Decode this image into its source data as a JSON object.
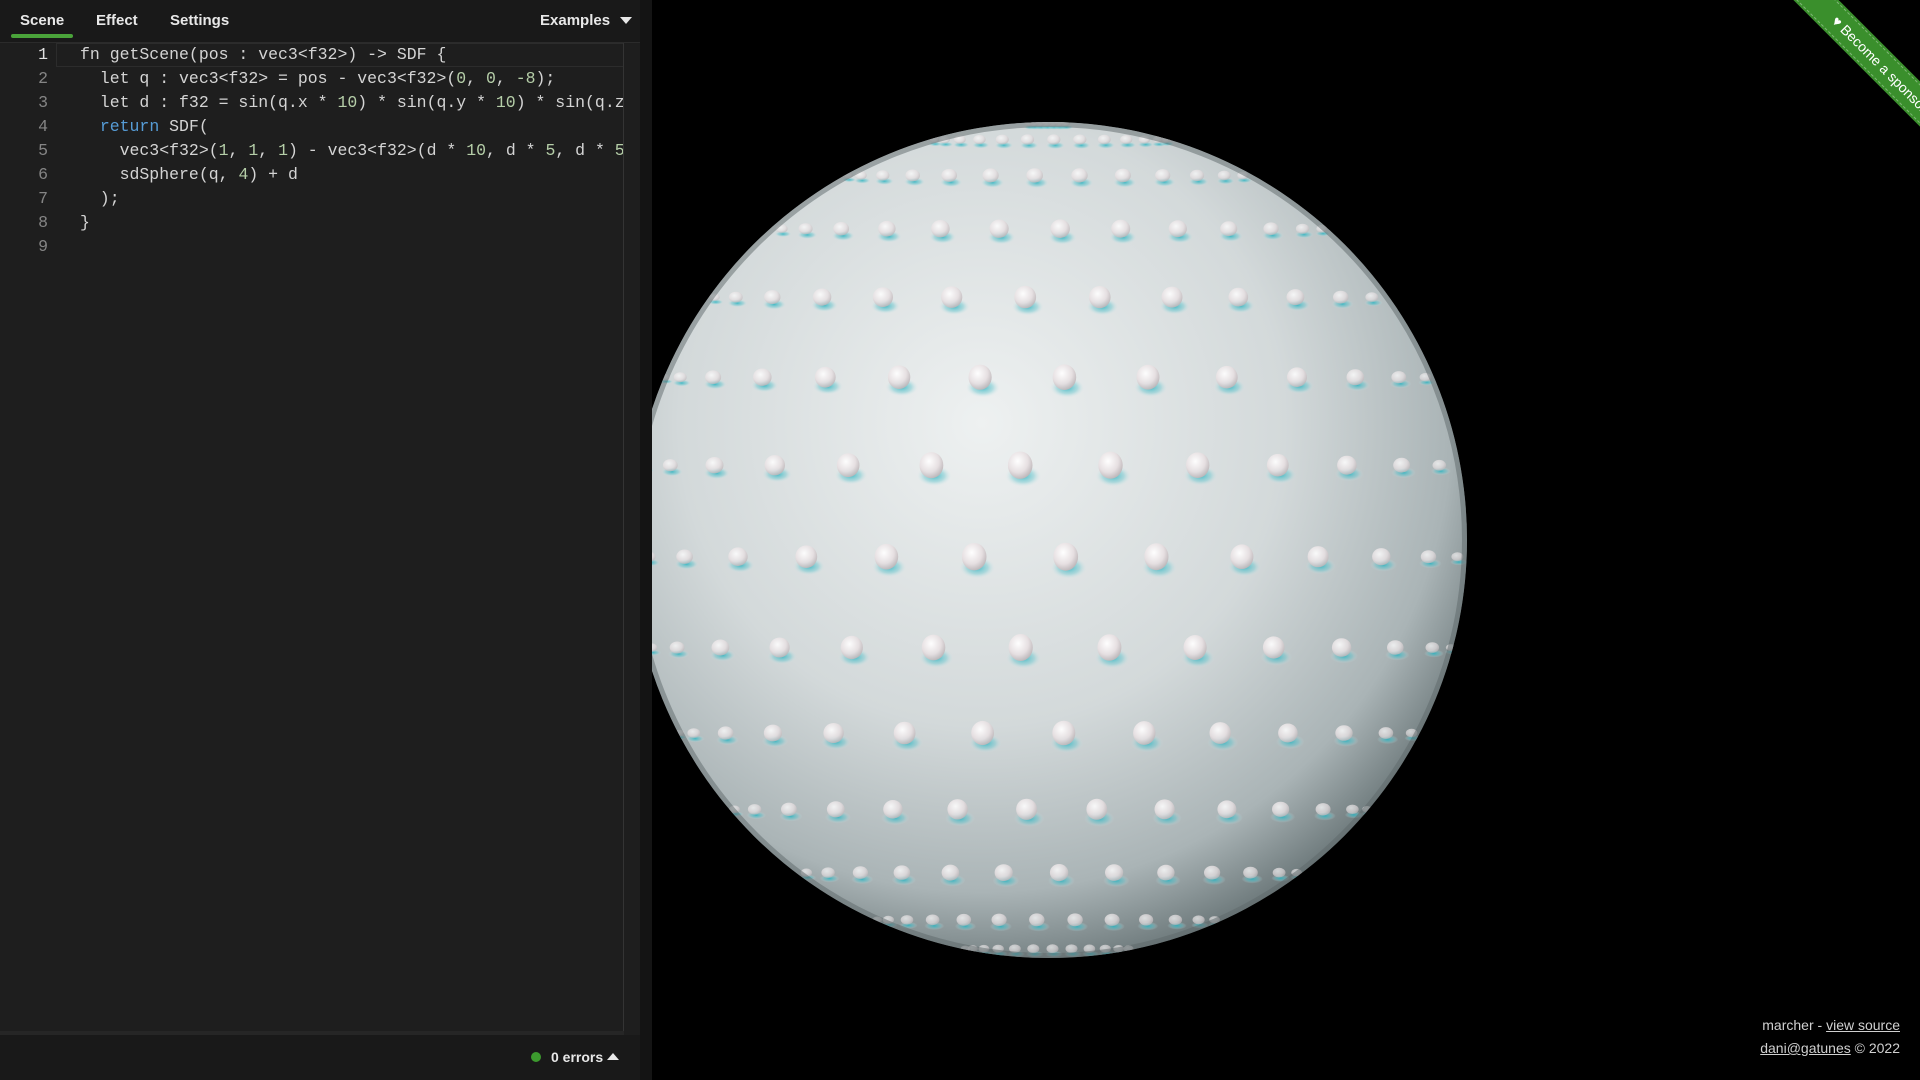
{
  "tabs": [
    {
      "label": "Scene",
      "active": true
    },
    {
      "label": "Effect",
      "active": false
    },
    {
      "label": "Settings",
      "active": false
    }
  ],
  "examples_label": "Examples",
  "editor": {
    "line_numbers": [
      "1",
      "2",
      "3",
      "4",
      "5",
      "6",
      "7",
      "8",
      "9"
    ],
    "current_line": 1,
    "lines": [
      [
        {
          "t": "fn getScene(pos : vec3<f32>) -> SDF {",
          "c": ""
        }
      ],
      [
        {
          "t": "  let q : vec3<f32> = pos - vec3<f32>(",
          "c": ""
        },
        {
          "t": "0",
          "c": "num"
        },
        {
          "t": ", ",
          "c": ""
        },
        {
          "t": "0",
          "c": "num"
        },
        {
          "t": ", ",
          "c": ""
        },
        {
          "t": "-8",
          "c": "num"
        },
        {
          "t": ");",
          "c": ""
        }
      ],
      [
        {
          "t": "  let d : f32 = sin(q.x * ",
          "c": ""
        },
        {
          "t": "10",
          "c": "num"
        },
        {
          "t": ") * sin(q.y * ",
          "c": ""
        },
        {
          "t": "10",
          "c": "num"
        },
        {
          "t": ") * sin(q.z *",
          "c": ""
        }
      ],
      [
        {
          "t": "  ",
          "c": ""
        },
        {
          "t": "return",
          "c": "kw"
        },
        {
          "t": " SDF(",
          "c": ""
        }
      ],
      [
        {
          "t": "    vec3<f32>(",
          "c": ""
        },
        {
          "t": "1",
          "c": "num"
        },
        {
          "t": ", ",
          "c": ""
        },
        {
          "t": "1",
          "c": "num"
        },
        {
          "t": ", ",
          "c": ""
        },
        {
          "t": "1",
          "c": "num"
        },
        {
          "t": ") - vec3<f32>(d * ",
          "c": ""
        },
        {
          "t": "10",
          "c": "num"
        },
        {
          "t": ", d * ",
          "c": ""
        },
        {
          "t": "5",
          "c": "num"
        },
        {
          "t": ", d * ",
          "c": ""
        },
        {
          "t": "5",
          "c": "num"
        },
        {
          "t": "),",
          "c": ""
        }
      ],
      [
        {
          "t": "    sdSphere(q, ",
          "c": ""
        },
        {
          "t": "4",
          "c": "num"
        },
        {
          "t": ") + d",
          "c": ""
        }
      ],
      [
        {
          "t": "  );",
          "c": ""
        }
      ],
      [
        {
          "t": "}",
          "c": ""
        }
      ],
      [
        {
          "t": "",
          "c": ""
        }
      ]
    ]
  },
  "status": {
    "errors_text": "0 errors",
    "dot_color": "#3c9a2e"
  },
  "ribbon_text": "♥ Become a sponsor",
  "credits": {
    "app_name": "marcher",
    "separator": " - ",
    "view_source": "view source",
    "author_link": "dani@gatunes",
    "copyright": " © 2022"
  },
  "colors": {
    "accent": "#4aa33a",
    "editor_bg": "#1e1e1e",
    "keyword": "#569cd6",
    "number": "#b5cea8",
    "sphere_base": "#d8dcdc",
    "sphere_cavity": "#2bb3c0"
  }
}
